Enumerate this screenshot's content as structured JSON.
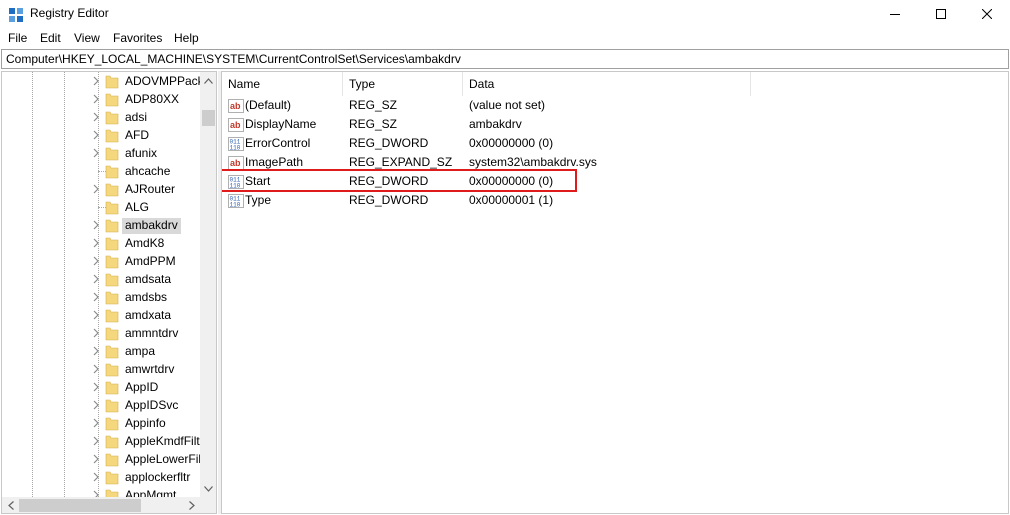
{
  "window": {
    "title": "Registry Editor",
    "app_icon": "registry-editor-icon",
    "controls": [
      "minimize-icon",
      "maximize-icon",
      "close-icon"
    ]
  },
  "menu": [
    "File",
    "Edit",
    "View",
    "Favorites",
    "Help"
  ],
  "address": "Computer\\HKEY_LOCAL_MACHINE\\SYSTEM\\CurrentControlSet\\Services\\ambakdrv",
  "tree": {
    "items": [
      {
        "label": "ADOVMPPackage",
        "expandable": true,
        "selected": false
      },
      {
        "label": "ADP80XX",
        "expandable": true,
        "selected": false
      },
      {
        "label": "adsi",
        "expandable": true,
        "selected": false
      },
      {
        "label": "AFD",
        "expandable": true,
        "selected": false
      },
      {
        "label": "afunix",
        "expandable": true,
        "selected": false
      },
      {
        "label": "ahcache",
        "expandable": false,
        "selected": false
      },
      {
        "label": "AJRouter",
        "expandable": true,
        "selected": false
      },
      {
        "label": "ALG",
        "expandable": false,
        "selected": false
      },
      {
        "label": "ambakdrv",
        "expandable": true,
        "selected": true
      },
      {
        "label": "AmdK8",
        "expandable": true,
        "selected": false
      },
      {
        "label": "AmdPPM",
        "expandable": true,
        "selected": false
      },
      {
        "label": "amdsata",
        "expandable": true,
        "selected": false
      },
      {
        "label": "amdsbs",
        "expandable": true,
        "selected": false
      },
      {
        "label": "amdxata",
        "expandable": true,
        "selected": false
      },
      {
        "label": "ammntdrv",
        "expandable": true,
        "selected": false
      },
      {
        "label": "ampa",
        "expandable": true,
        "selected": false
      },
      {
        "label": "amwrtdrv",
        "expandable": true,
        "selected": false
      },
      {
        "label": "AppID",
        "expandable": true,
        "selected": false
      },
      {
        "label": "AppIDSvc",
        "expandable": true,
        "selected": false
      },
      {
        "label": "Appinfo",
        "expandable": true,
        "selected": false
      },
      {
        "label": "AppleKmdfFilter",
        "expandable": true,
        "selected": false
      },
      {
        "label": "AppleLowerFilter",
        "expandable": true,
        "selected": false
      },
      {
        "label": "applockerfltr",
        "expandable": true,
        "selected": false
      },
      {
        "label": "AppMgmt",
        "expandable": true,
        "selected": false
      }
    ]
  },
  "list": {
    "columns": [
      "Name",
      "Type",
      "Data"
    ],
    "rows": [
      {
        "name": "(Default)",
        "type": "REG_SZ",
        "data": "(value not set)",
        "icon": "string-value-icon"
      },
      {
        "name": "DisplayName",
        "type": "REG_SZ",
        "data": "ambakdrv",
        "icon": "string-value-icon"
      },
      {
        "name": "ErrorControl",
        "type": "REG_DWORD",
        "data": "0x00000000 (0)",
        "icon": "binary-value-icon"
      },
      {
        "name": "ImagePath",
        "type": "REG_EXPAND_SZ",
        "data": "system32\\ambakdrv.sys",
        "icon": "string-value-icon"
      },
      {
        "name": "Start",
        "type": "REG_DWORD",
        "data": "0x00000000 (0)",
        "icon": "binary-value-icon",
        "highlighted": true
      },
      {
        "name": "Type",
        "type": "REG_DWORD",
        "data": "0x00000001 (1)",
        "icon": "binary-value-icon"
      }
    ]
  },
  "colors": {
    "highlight_border": "#e01b1b",
    "selection": "#d9d9d9",
    "folder": "#f5d77d",
    "string_icon": "#c0392b",
    "binary_icon": "#2a5db0"
  }
}
